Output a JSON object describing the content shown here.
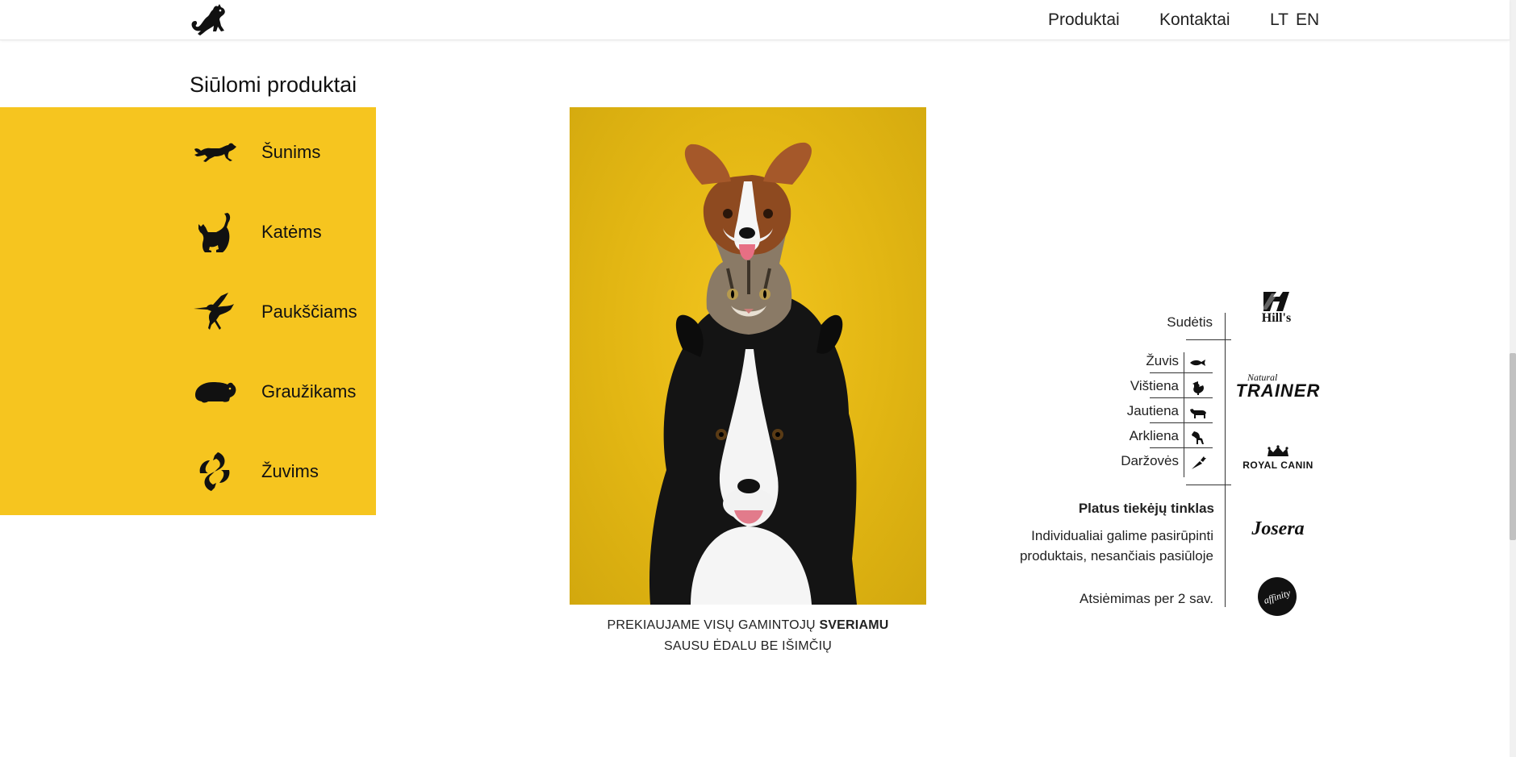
{
  "header": {
    "logo_icon": "dog-cat-logo-icon",
    "nav": {
      "produktai": "Produktai",
      "kontaktai": "Kontaktai",
      "lt": "LT",
      "en": "EN"
    }
  },
  "section": {
    "title": "Siūlomi produktai"
  },
  "categories": [
    {
      "label": "Šunims",
      "icon": "running-dog-icon"
    },
    {
      "label": "Katėms",
      "icon": "sitting-cat-icon"
    },
    {
      "label": "Paukščiams",
      "icon": "hummingbird-icon"
    },
    {
      "label": "Graužikams",
      "icon": "guinea-pig-icon"
    },
    {
      "label": "Žuvims",
      "icon": "fish-icon"
    }
  ],
  "caption": {
    "line1_prefix": "PREKIAUJAME VISŲ GAMINTOJŲ ",
    "line1_bold": "SVERIAMU",
    "line2": "SAUSU ĖDALU BE IŠIMČIŲ"
  },
  "info": {
    "composition_title": "Sudėtis",
    "rows": [
      {
        "label": "Žuvis",
        "icon": "fish-icon"
      },
      {
        "label": "Vištiena",
        "icon": "chicken-icon"
      },
      {
        "label": "Jautiena",
        "icon": "cow-icon"
      },
      {
        "label": "Arkliena",
        "icon": "horse-icon"
      },
      {
        "label": "Daržovės",
        "icon": "carrot-icon"
      }
    ],
    "network_title": "Platus tiekėjų tinklas",
    "network_line1": "Individualiai galime pasirūpinti",
    "network_line2": "produktais, nesančiais pasiūloje",
    "pickup": "Atsiėmimas per 2 sav."
  },
  "brands": {
    "hills": "Hill's",
    "natural_small": "Natural",
    "trainer": "TRAINER",
    "royal_canin": "ROYAL CANIN",
    "josera": "Josera",
    "affinity": "affinity"
  },
  "colors": {
    "accent_yellow": "#f6c51f",
    "photo_yellow": "#dcb012",
    "text": "#111111"
  }
}
